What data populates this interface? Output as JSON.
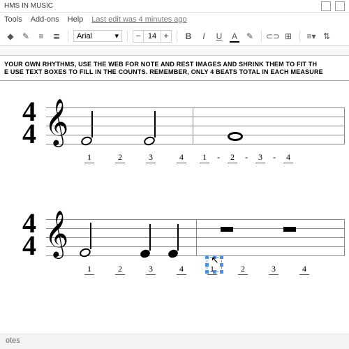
{
  "titlebar": {
    "title": "HMS IN MUSIC"
  },
  "menubar": {
    "tools": "Tools",
    "addons": "Add-ons",
    "help": "Help",
    "last_edit": "Last edit was 4 minutes ago"
  },
  "toolbar": {
    "font": "Arial",
    "size": "14",
    "minus": "−",
    "plus": "+",
    "bold": "B",
    "italic": "I",
    "underline": "U",
    "color": "A"
  },
  "instructions": {
    "line1": "YOUR OWN RHYTHMS, USE THE WEB FOR NOTE AND REST IMAGES AND SHRINK THEM TO FIT TH",
    "line2": "E USE TEXT BOXES TO FILL IN THE COUNTS. REMEMBER, ONLY 4 BEATS TOTAL IN EACH MEASURE"
  },
  "staff1": {
    "clef": "𝄞",
    "ts_top": "4",
    "ts_bot": "4",
    "counts": [
      "1",
      "2",
      "3",
      "4",
      "1",
      "-",
      "2",
      "-",
      "3",
      "-",
      "4"
    ]
  },
  "staff2": {
    "clef": "𝄞",
    "ts_top": "4",
    "ts_bot": "4",
    "counts": [
      "1",
      "2",
      "3",
      "4",
      "1",
      "2",
      "3",
      "4"
    ]
  },
  "footer": {
    "label": "otes"
  }
}
